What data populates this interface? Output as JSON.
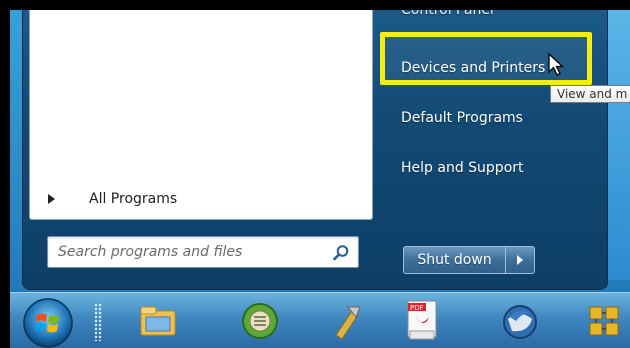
{
  "start_menu": {
    "all_programs_label": "All Programs",
    "search": {
      "placeholder": "Search programs and files"
    },
    "right_pane": {
      "cut_item_label": "Control Panel",
      "items": [
        {
          "label": "Devices and Printers"
        },
        {
          "label": "Default Programs"
        },
        {
          "label": "Help and Support"
        }
      ]
    },
    "shutdown_label": "Shut down",
    "tooltip_text": "View and m"
  },
  "colors": {
    "highlight_box": "#f4ec18",
    "start_menu_bg": "#124a74",
    "taskbar_bg": "#3f87bf"
  },
  "taskbar": {
    "items": [
      {
        "icon": "windows-orb-icon"
      },
      {
        "icon": "file-explorer-icon"
      },
      {
        "icon": "media-player-icon"
      },
      {
        "icon": "tools-icon"
      },
      {
        "icon": "pdf-document-icon"
      },
      {
        "icon": "thunderbird-icon"
      },
      {
        "icon": "network-icon"
      }
    ]
  }
}
